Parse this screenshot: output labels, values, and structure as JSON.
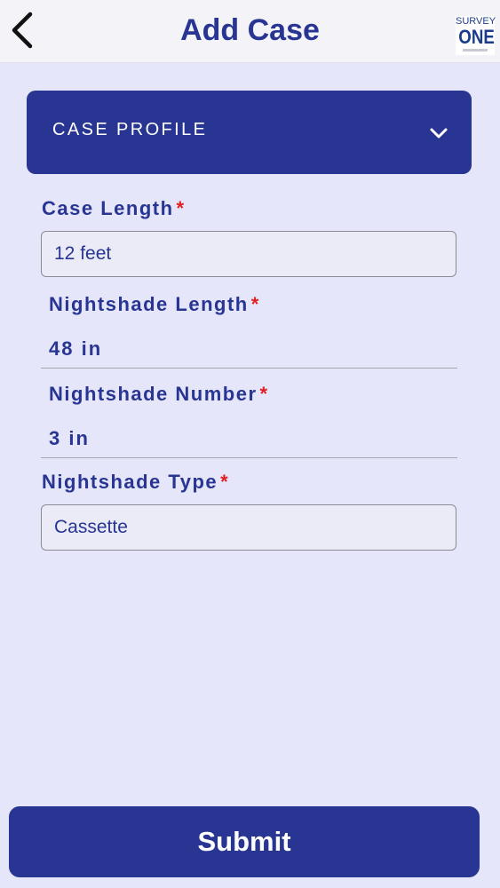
{
  "header": {
    "title": "Add Case",
    "back_icon": "chevron-left-icon",
    "logo": {
      "top_text": "SURVEY",
      "main_text": "ONE",
      "color": "#1b3c8a"
    }
  },
  "section": {
    "label": "CASE PROFILE",
    "icon": "chevron-down-icon",
    "expanded": true
  },
  "fields": {
    "case_length": {
      "label": "Case Length",
      "required_mark": "*",
      "value": "12 feet"
    },
    "nightshade_length": {
      "label": "Nightshade Length",
      "required_mark": "*",
      "value": "48 in"
    },
    "nightshade_number": {
      "label": "Nightshade Number",
      "required_mark": "*",
      "value": "3 in"
    },
    "nightshade_type": {
      "label": "Nightshade Type",
      "required_mark": "*",
      "value": "Cassette"
    }
  },
  "submit": {
    "label": "Submit"
  },
  "colors": {
    "background": "#e6e6fa",
    "primary": "#283593",
    "required": "#e02020",
    "header_bg": "#f4f4f8"
  }
}
